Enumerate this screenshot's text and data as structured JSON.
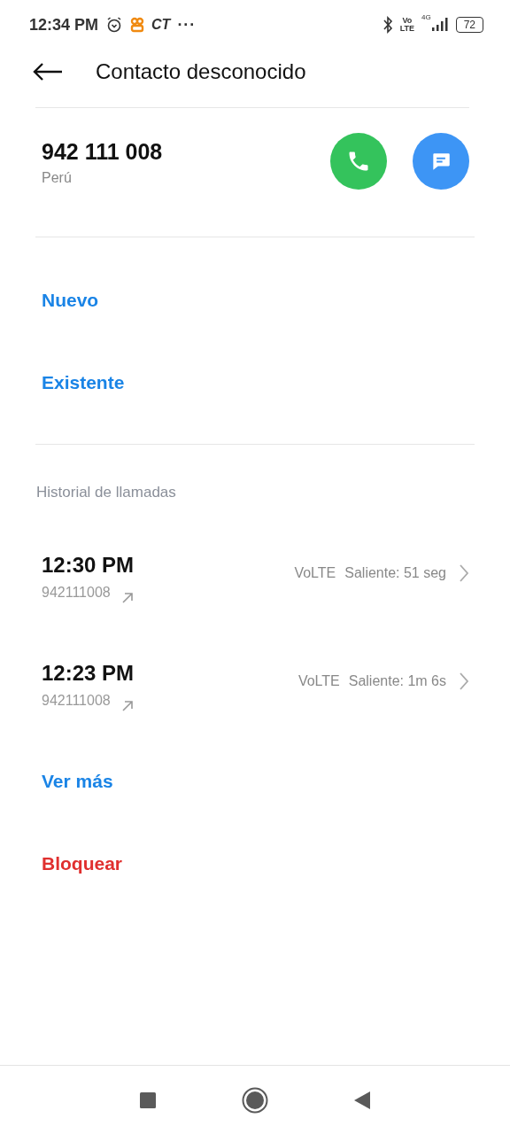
{
  "status_bar": {
    "time": "12:34 PM",
    "carrier": "CT",
    "more": "···",
    "network_top": "Vo",
    "network_bottom": "LTE",
    "generation": "4G",
    "battery": "72"
  },
  "header": {
    "title": "Contacto desconocido"
  },
  "contact": {
    "number": "942 111 008",
    "country": "Perú"
  },
  "add_actions": [
    {
      "label": "Nuevo",
      "kind": "link"
    },
    {
      "label": "Existente",
      "kind": "link"
    }
  ],
  "history": {
    "title": "Historial de llamadas",
    "calls": [
      {
        "time": "12:30 PM",
        "number": "942111008",
        "network": "VoLTE",
        "detail": "Saliente: 51 seg"
      },
      {
        "time": "12:23 PM",
        "number": "942111008",
        "network": "VoLTE",
        "detail": "Saliente: 1m 6s"
      }
    ]
  },
  "more_actions": [
    {
      "label": "Ver más",
      "kind": "link"
    },
    {
      "label": "Bloquear",
      "kind": "danger"
    }
  ]
}
